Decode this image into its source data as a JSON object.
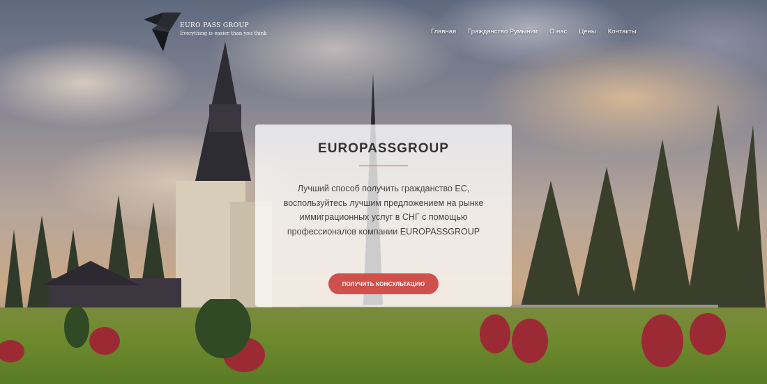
{
  "brand": {
    "name": "EURO PASS GROUP",
    "tagline": "Everything is easier than you think"
  },
  "nav": {
    "items": [
      {
        "label": "Главная"
      },
      {
        "label": "Гражданство Румынии"
      },
      {
        "label": "О нас"
      },
      {
        "label": "Цены"
      },
      {
        "label": "Контакты"
      }
    ]
  },
  "hero": {
    "title": "EUROPASSGROUP",
    "description": "Лучший способ получить гражданство ЕС, воспользуйтесь лучшим предложением на рынке иммиграционных услуг в СНГ с помощью профессионалов компании EUROPASSGROUP",
    "cta_label": "ПОЛУЧИТЬ КОНСУЛЬТАЦИЮ"
  },
  "colors": {
    "accent": "#d0514b",
    "text_dark": "#333333"
  }
}
